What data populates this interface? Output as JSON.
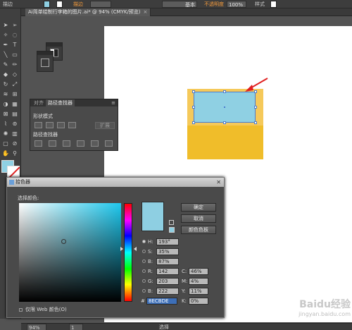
{
  "control_bar": {
    "tool_label": "描边",
    "opacity_label": "不透明度",
    "opacity_value": "100%",
    "stroke_style": "基本",
    "style_label": "样式",
    "stroke_width_label": "描边"
  },
  "document_tab": {
    "title": "Ai简单绘制行李箱的图片.ai* @ 94% (CMYK/预览)",
    "close": "×"
  },
  "pathfinder_panel": {
    "tabs": [
      "对齐",
      "路径查找器"
    ],
    "shape_modes_label": "形状模式",
    "pathfinders_label": "路径查找器",
    "expand_label": "扩展",
    "menu_glyph": "≡"
  },
  "color_picker": {
    "title": "拾色器",
    "close": "✕",
    "select_color_label": "选择颜色:",
    "buttons": {
      "ok": "确定",
      "cancel": "取消",
      "swatches": "颜色色板"
    },
    "hsb": [
      {
        "label": "H:",
        "value": "193°"
      },
      {
        "label": "S:",
        "value": "35%"
      },
      {
        "label": "B:",
        "value": "87%"
      }
    ],
    "rgb": [
      {
        "label": "R:",
        "value": "142"
      },
      {
        "label": "G:",
        "value": "203"
      },
      {
        "label": "B:",
        "value": "222"
      }
    ],
    "cmyk": [
      {
        "label": "C:",
        "value": "46%"
      },
      {
        "label": "M:",
        "value": "4%"
      },
      {
        "label": "Y:",
        "value": "11%"
      },
      {
        "label": "K:",
        "value": "0%"
      }
    ],
    "hex_label": "#",
    "hex_value": "8ECBDE",
    "web_only_label": "仅限 Web 颜色(O)",
    "selected_color": "#8ECBDE"
  },
  "status_bar": {
    "zoom": "94%",
    "page": "1",
    "mode": "选择"
  },
  "watermark": {
    "brand": "Baidu经验",
    "url": "jingyan.baidu.com"
  },
  "colors": {
    "fill": "#8ecfe2",
    "suitcase_body": "#f0bd2a",
    "selection": "#4a7bd0",
    "arrow": "#e02020"
  }
}
